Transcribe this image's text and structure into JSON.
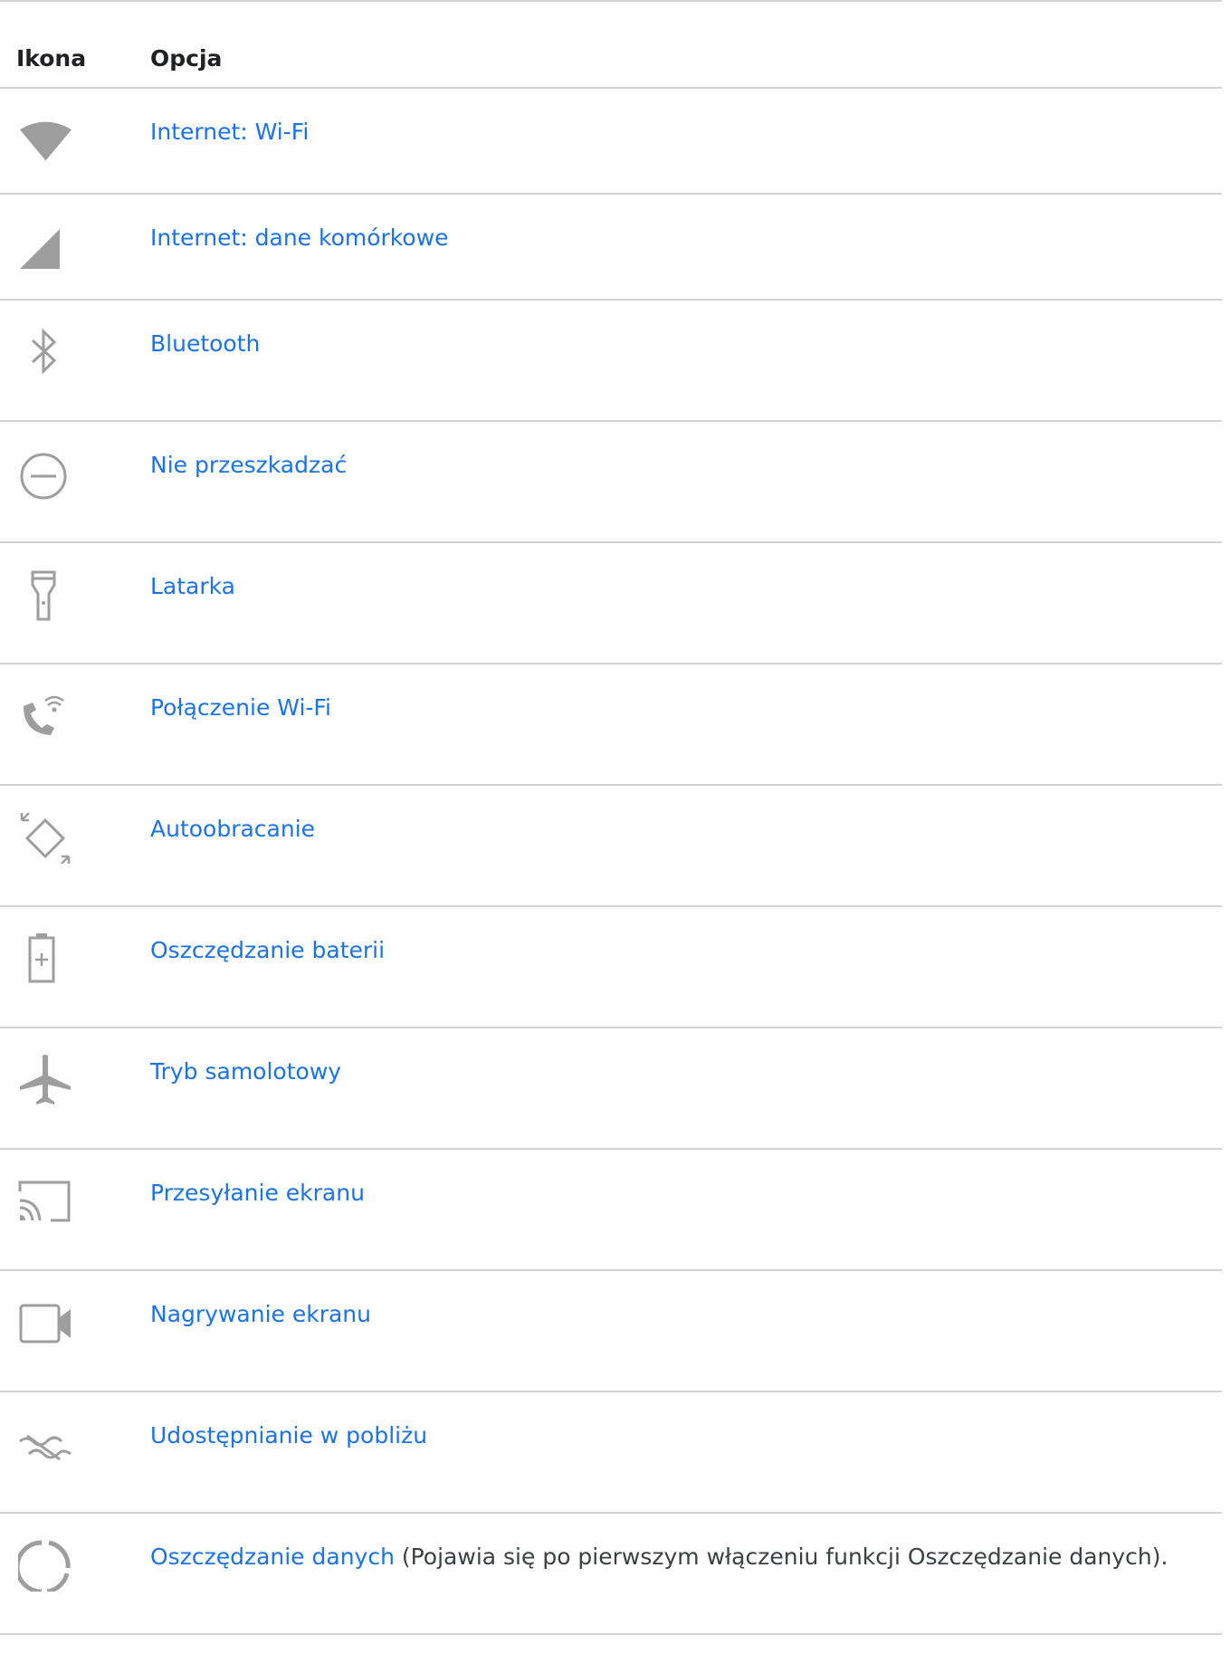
{
  "header": {
    "icon_col": "Ikona",
    "option_col": "Opcja"
  },
  "rows": [
    {
      "icon": "wifi-icon",
      "label": "Internet: Wi-Fi"
    },
    {
      "icon": "cellular-signal-icon",
      "label": "Internet: dane komórkowe"
    },
    {
      "icon": "bluetooth-icon",
      "label": "Bluetooth"
    },
    {
      "icon": "do-not-disturb-icon",
      "label": "Nie przeszkadzać"
    },
    {
      "icon": "flashlight-icon",
      "label": "Latarka"
    },
    {
      "icon": "wifi-calling-icon",
      "label": "Połączenie Wi-Fi"
    },
    {
      "icon": "auto-rotate-icon",
      "label": "Autoobracanie"
    },
    {
      "icon": "battery-saver-icon",
      "label": "Oszczędzanie baterii"
    },
    {
      "icon": "airplane-icon",
      "label": "Tryb samolotowy"
    },
    {
      "icon": "cast-icon",
      "label": "Przesyłanie ekranu"
    },
    {
      "icon": "screen-record-icon",
      "label": "Nagrywanie ekranu"
    },
    {
      "icon": "nearby-share-icon",
      "label": "Udostępnianie w pobliżu"
    },
    {
      "icon": "data-saver-icon",
      "label": "Oszczędzanie danych",
      "note": " (Pojawia się po pierwszym włączeniu funkcji Oszczędzanie danych)."
    }
  ],
  "colors": {
    "link": "#1a73e8",
    "icon_gray": "#9e9e9e",
    "divider": "#d2d2d2"
  }
}
